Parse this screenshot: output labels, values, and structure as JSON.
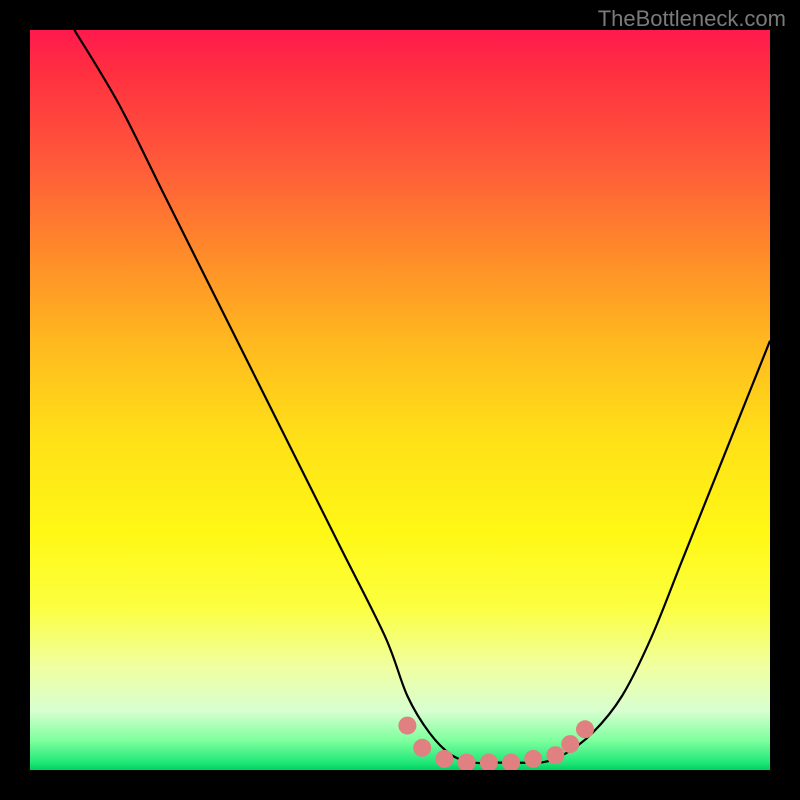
{
  "watermark": "TheBottleneck.com",
  "chart_data": {
    "type": "line",
    "title": "",
    "xlabel": "",
    "ylabel": "",
    "xlim": [
      0,
      100
    ],
    "ylim": [
      0,
      100
    ],
    "series": [
      {
        "name": "bottleneck-curve",
        "x": [
          6,
          12,
          18,
          24,
          30,
          36,
          42,
          48,
          51,
          54,
          57,
          60,
          63,
          66,
          69,
          72,
          76,
          80,
          84,
          88,
          92,
          96,
          100
        ],
        "y": [
          100,
          90,
          78,
          66,
          54,
          42,
          30,
          18,
          10,
          5,
          2,
          1,
          1,
          1,
          1,
          2,
          5,
          10,
          18,
          28,
          38,
          48,
          58
        ]
      }
    ],
    "markers": {
      "name": "highlight-dots",
      "color": "#e08080",
      "points": [
        {
          "x": 51,
          "y": 6
        },
        {
          "x": 53,
          "y": 3
        },
        {
          "x": 56,
          "y": 1.5
        },
        {
          "x": 59,
          "y": 1
        },
        {
          "x": 62,
          "y": 1
        },
        {
          "x": 65,
          "y": 1
        },
        {
          "x": 68,
          "y": 1.5
        },
        {
          "x": 71,
          "y": 2
        },
        {
          "x": 73,
          "y": 3.5
        },
        {
          "x": 75,
          "y": 5.5
        }
      ]
    },
    "gradient_stops": [
      {
        "pos": 0,
        "color": "#ff1a4d"
      },
      {
        "pos": 50,
        "color": "#ffe018"
      },
      {
        "pos": 96,
        "color": "#7eff9e"
      },
      {
        "pos": 100,
        "color": "#00d060"
      }
    ]
  }
}
